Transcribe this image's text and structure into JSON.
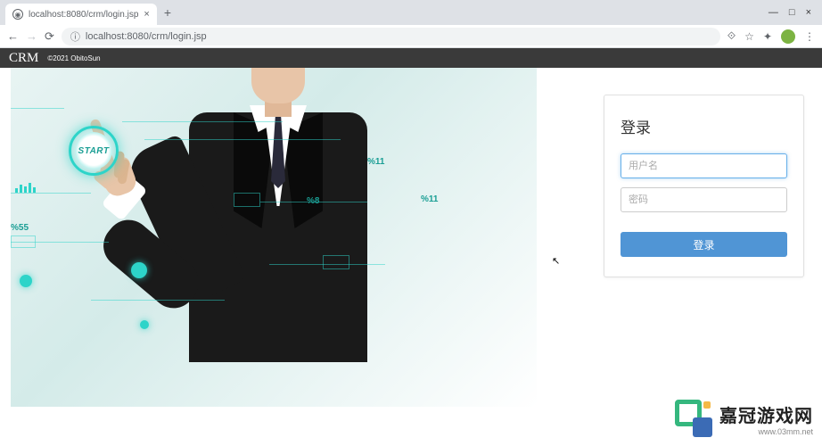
{
  "browser": {
    "tab_title": "localhost:8080/crm/login.jsp",
    "url": "localhost:8080/crm/login.jsp"
  },
  "header": {
    "brand": "CRM",
    "copyright": "©2021 ObitoSun"
  },
  "hero": {
    "start_label": "START",
    "pct_labels": [
      "%11",
      "%8",
      "%11",
      "%55"
    ]
  },
  "login": {
    "title": "登录",
    "username_placeholder": "用户名",
    "password_placeholder": "密码",
    "button_label": "登录"
  },
  "watermark": {
    "title": "嘉冠游戏网",
    "url": "www.03mm.net"
  }
}
